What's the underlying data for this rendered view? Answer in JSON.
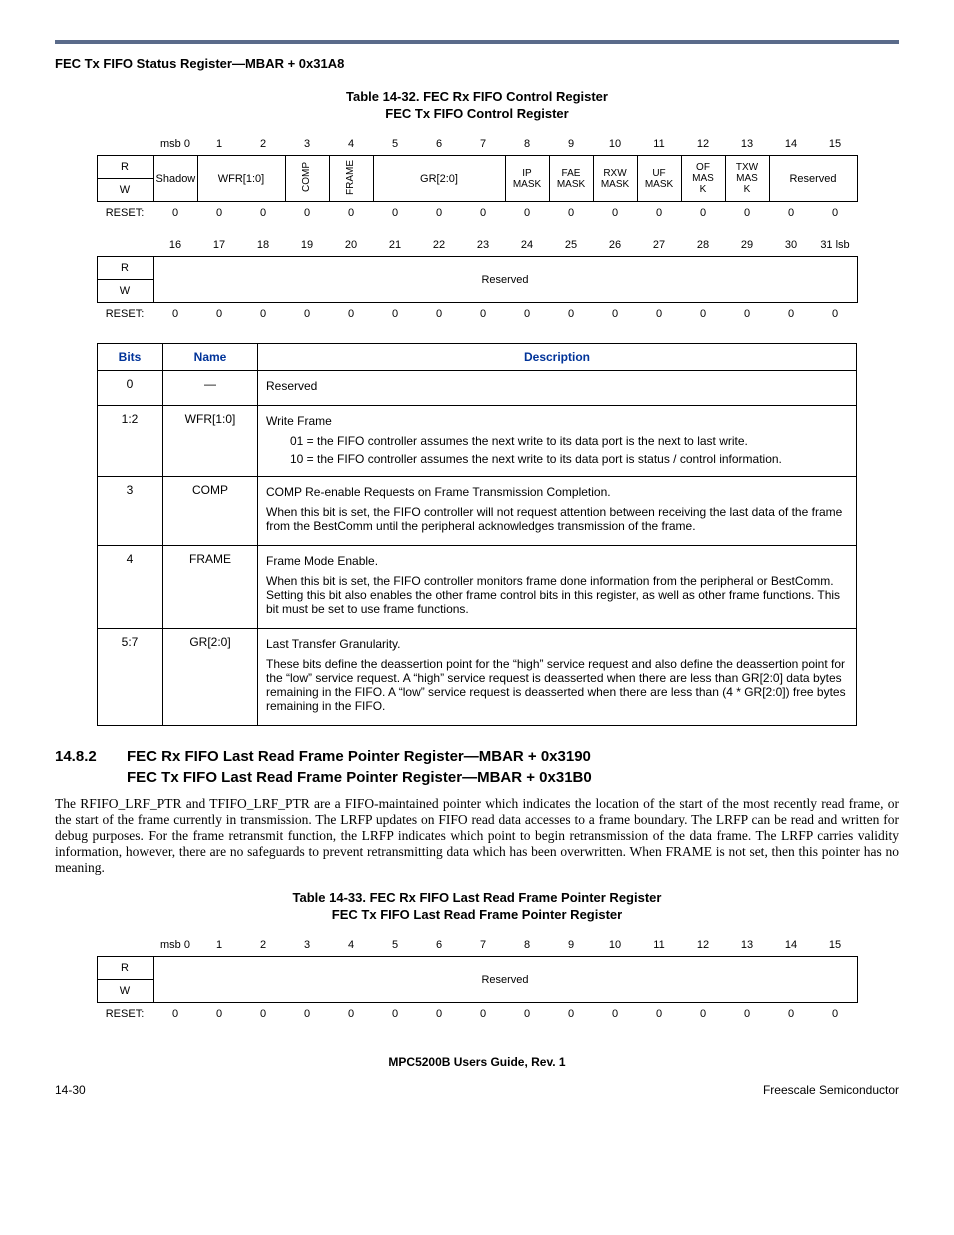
{
  "header": {
    "title": "FEC Tx FIFO Status Register—MBAR + 0x31A8"
  },
  "table32": {
    "caption": "Table 14-32. FEC Rx FIFO Control Register",
    "subcaption": "FEC Tx FIFO Control Register",
    "bits_row1": [
      "msb 0",
      "1",
      "2",
      "3",
      "4",
      "5",
      "6",
      "7",
      "8",
      "9",
      "10",
      "11",
      "12",
      "13",
      "14",
      "15"
    ],
    "labels": {
      "R": "R",
      "W": "W",
      "RESET": "RESET:"
    },
    "fields_upper": {
      "shadow": "Shadow",
      "wfr": "WFR[1:0]",
      "comp": "COMP",
      "frame": "FRAME",
      "gr": "GR[2:0]",
      "ipmask": "IP\nMASK",
      "faemask": "FAE\nMASK",
      "rxwmask": "RXW\nMASK",
      "ufmask": "UF\nMASK",
      "ofmask": "OF\nMAS\nK",
      "txwmask": "TXW\nMAS\nK",
      "reserved": "Reserved"
    },
    "reset_row1": [
      "0",
      "0",
      "0",
      "0",
      "0",
      "0",
      "0",
      "0",
      "0",
      "0",
      "0",
      "0",
      "0",
      "0",
      "0",
      "0"
    ],
    "bits_row2": [
      "16",
      "17",
      "18",
      "19",
      "20",
      "21",
      "22",
      "23",
      "24",
      "25",
      "26",
      "27",
      "28",
      "29",
      "30",
      "31 lsb"
    ],
    "fields_lower": {
      "reserved": "Reserved"
    },
    "reset_row2": [
      "0",
      "0",
      "0",
      "0",
      "0",
      "0",
      "0",
      "0",
      "0",
      "0",
      "0",
      "0",
      "0",
      "0",
      "0",
      "0"
    ]
  },
  "desc_table": {
    "headers": [
      "Bits",
      "Name",
      "Description"
    ],
    "rows": [
      {
        "bits": "0",
        "name": "—",
        "desc": [
          {
            "t": "p",
            "v": "Reserved"
          }
        ]
      },
      {
        "bits": "1:2",
        "name": "WFR[1:0]",
        "desc": [
          {
            "t": "p",
            "v": "Write Frame"
          },
          {
            "t": "li",
            "v": "01 = the FIFO controller assumes the next write to its data port is the next to last write."
          },
          {
            "t": "li",
            "v": "10 = the FIFO controller assumes the next write to its data port is status / control information."
          }
        ]
      },
      {
        "bits": "3",
        "name": "COMP",
        "desc": [
          {
            "t": "p",
            "v": "COMP Re-enable Requests on Frame Transmission Completion."
          },
          {
            "t": "p",
            "v": "When this bit is set, the FIFO controller will not request attention between receiving the last data of the frame from the BestComm until the peripheral acknowledges transmission of the frame."
          }
        ]
      },
      {
        "bits": "4",
        "name": "FRAME",
        "desc": [
          {
            "t": "p",
            "v": "Frame Mode Enable."
          },
          {
            "t": "p",
            "v": "When this bit is set, the FIFO controller monitors frame done information from the peripheral or BestComm. Setting this bit also enables the other frame control bits in this register, as well as other frame functions. This bit must be set to use frame functions."
          }
        ]
      },
      {
        "bits": "5:7",
        "name": "GR[2:0]",
        "desc": [
          {
            "t": "p",
            "v": "Last Transfer Granularity."
          },
          {
            "t": "p",
            "v": "These bits define the deassertion point for the “high” service request and also define the deassertion point for the “low” service request. A “high” service request is deasserted when there are less than GR[2:0] data bytes remaining in the FIFO. A “low” service request is deasserted when there are less than (4 * GR[2:0]) free bytes remaining in the FIFO."
          }
        ]
      }
    ]
  },
  "section": {
    "num": "14.8.2",
    "line1": "FEC Rx FIFO Last Read Frame Pointer Register—MBAR + 0x3190",
    "line2": "FEC Tx FIFO Last Read Frame Pointer Register—MBAR + 0x31B0",
    "body": "The RFIFO_LRF_PTR and TFIFO_LRF_PTR are a FIFO-maintained pointer which indicates the location of the start of the most recently read frame, or the start of the frame currently in transmission. The LRFP updates on FIFO read data accesses to a frame boundary. The LRFP can be read and written for debug purposes. For the frame retransmit function, the LRFP indicates which point to begin retransmission of the data frame. The LRFP carries validity information, however, there are no safeguards to prevent retransmitting data which has been overwritten. When FRAME is not set, then this pointer has no meaning."
  },
  "table33": {
    "caption": "Table 14-33. FEC Rx FIFO Last Read Frame Pointer Register",
    "subcaption": "FEC Tx FIFO Last Read Frame Pointer Register",
    "bits_row1": [
      "msb 0",
      "1",
      "2",
      "3",
      "4",
      "5",
      "6",
      "7",
      "8",
      "9",
      "10",
      "11",
      "12",
      "13",
      "14",
      "15"
    ],
    "fields": {
      "reserved": "Reserved"
    },
    "reset_row1": [
      "0",
      "0",
      "0",
      "0",
      "0",
      "0",
      "0",
      "0",
      "0",
      "0",
      "0",
      "0",
      "0",
      "0",
      "0",
      "0"
    ]
  },
  "footer": {
    "center": "MPC5200B Users Guide, Rev. 1",
    "left": "14-30",
    "right": "Freescale Semiconductor"
  }
}
